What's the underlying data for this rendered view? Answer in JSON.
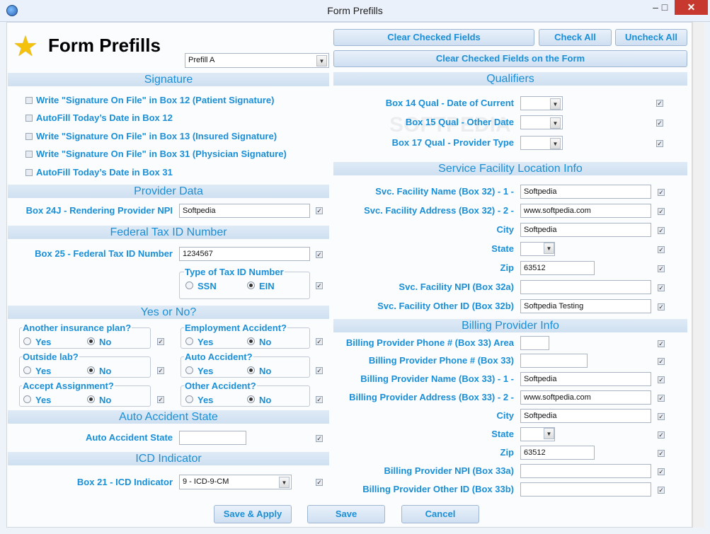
{
  "window": {
    "title": "Form Prefills",
    "minimize": "–",
    "maximize": "□",
    "close": "✕"
  },
  "header": {
    "title": "Form Prefills",
    "prefill_select": "Prefill A"
  },
  "top_buttons": {
    "clear_checked": "Clear Checked Fields",
    "check_all": "Check All",
    "uncheck_all": "Uncheck All",
    "clear_on_form": "Clear Checked Fields on the Form"
  },
  "signature": {
    "heading": "Signature",
    "items": [
      "Write \"Signature On File\" in Box 12 (Patient Signature)",
      "AutoFill Today’s Date in Box 12",
      "Write \"Signature On File\" in Box 13 (Insured Signature)",
      "Write \"Signature On File\" in Box 31 (Physician Signature)",
      "AutoFill Today’s Date in Box 31"
    ]
  },
  "provider_data": {
    "heading": "Provider Data",
    "label": "Box 24J - Rendering Provider NPI",
    "value": "Softpedia"
  },
  "federal_tax": {
    "heading": "Federal Tax ID Number",
    "label": "Box 25 - Federal Tax ID Number",
    "value": "1234567",
    "type_title": "Type of Tax ID Number",
    "ssn": "SSN",
    "ein": "EIN"
  },
  "yes_no": {
    "heading": "Yes or No?",
    "yes": "Yes",
    "no": "No",
    "groups": [
      "Another insurance plan?",
      "Employment Accident?",
      "Outside lab?",
      "Auto Accident?",
      "Accept Assignment?",
      "Other Accident?"
    ]
  },
  "auto_accident": {
    "heading": "Auto Accident State",
    "label": "Auto Accident State",
    "value": ""
  },
  "icd": {
    "heading": "ICD Indicator",
    "label": "Box 21 - ICD Indicator",
    "value": "9 - ICD-9-CM"
  },
  "qualifiers": {
    "heading": "Qualifiers",
    "items": [
      "Box 14 Qual - Date of Current",
      "Box 15 Qual - Other Date",
      "Box 17 Qual - Provider Type"
    ]
  },
  "service_facility": {
    "heading": "Service Facility Location Info",
    "rows": [
      {
        "label": "Svc. Facility Name (Box 32) - 1 -",
        "value": "Softpedia"
      },
      {
        "label": "Svc. Facility Address (Box 32) - 2 -",
        "value": "www.softpedia.com"
      },
      {
        "label": "City",
        "value": "Softpedia"
      },
      {
        "label": "State",
        "value": ""
      },
      {
        "label": "Zip",
        "value": "63512"
      },
      {
        "label": "Svc. Facility NPI (Box 32a)",
        "value": ""
      },
      {
        "label": "Svc. Facility Other ID (Box 32b)",
        "value": "Softpedia Testing"
      }
    ]
  },
  "billing": {
    "heading": "Billing Provider Info",
    "rows": [
      {
        "label": "Billing Provider Phone # (Box 33) Area",
        "value": ""
      },
      {
        "label": "Billing Provider Phone # (Box 33)",
        "value": ""
      },
      {
        "label": "Billing Provider Name (Box 33) - 1 -",
        "value": "Softpedia"
      },
      {
        "label": "Billing Provider Address (Box 33) - 2 -",
        "value": "www.softpedia.com"
      },
      {
        "label": "City",
        "value": "Softpedia"
      },
      {
        "label": "State",
        "value": ""
      },
      {
        "label": "Zip",
        "value": "63512"
      },
      {
        "label": "Billing Provider NPI (Box 33a)",
        "value": ""
      },
      {
        "label": "Billing Provider Other ID (Box 33b)",
        "value": ""
      }
    ]
  },
  "footer": {
    "save_apply": "Save & Apply",
    "save": "Save",
    "cancel": "Cancel"
  },
  "icons": {
    "star": "star-icon",
    "check": "✓"
  }
}
